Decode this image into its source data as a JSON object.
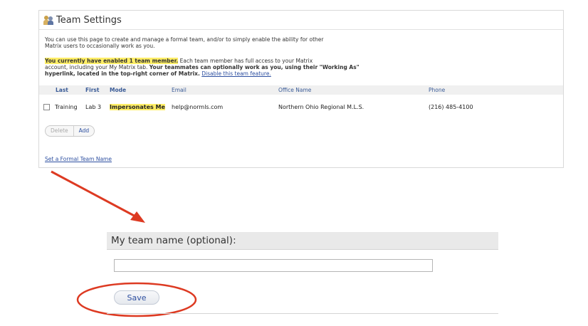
{
  "panel": {
    "title": "Team Settings",
    "intro_line1": "You can use this page to create and manage a formal team, and/or to simply enable the ability for other",
    "intro_line2": "Matrix users to occasionally work as you.",
    "notice_highlight": "You currently have enabled 1 team member.",
    "notice_text1": " Each team member has full access to your Matrix",
    "notice_text2": "account, including your My Matrix tab. ",
    "notice_bold": "Your teammates can optionally work as you, using their \"Working As\" hyperlink, located in the top-right corner of Matrix.",
    "disable_link": "Disable this team feature."
  },
  "table": {
    "headers": {
      "last": "Last",
      "first": "First",
      "mode": "Mode",
      "email": "Email",
      "office": "Office Name",
      "phone": "Phone"
    },
    "row": {
      "last": "Training",
      "first": "Lab 3",
      "mode": "Impersonates Me",
      "email": "help@normls.com",
      "office": "Northern Ohio Regional M.L.S.",
      "phone": "(216) 485-4100"
    }
  },
  "buttons": {
    "delete": "Delete",
    "add": "Add"
  },
  "formal_team_link": "Set a Formal Team Name",
  "team_name": {
    "label": "My team name (optional):",
    "value": "",
    "save": "Save"
  },
  "colors": {
    "highlight": "#ffee66",
    "link": "#2d4fa0",
    "annotation": "#dd3a22"
  },
  "icons": {
    "team": "team-icon"
  }
}
